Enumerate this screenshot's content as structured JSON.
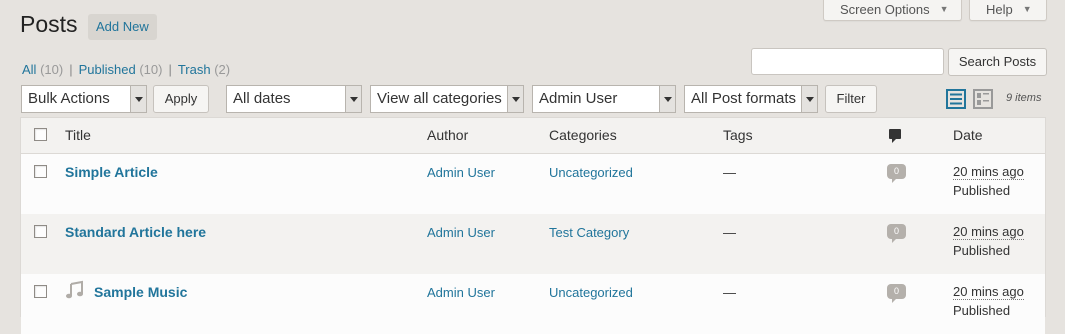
{
  "header": {
    "title": "Posts",
    "add_new": "Add New",
    "screen_options": "Screen Options",
    "help": "Help"
  },
  "filters_links": [
    {
      "label": "All",
      "count": "(10)"
    },
    {
      "label": "Published",
      "count": "(10)"
    },
    {
      "label": "Trash",
      "count": "(2)"
    }
  ],
  "search": {
    "value": "",
    "button": "Search Posts"
  },
  "toolbar": {
    "bulk_actions": "Bulk Actions",
    "apply": "Apply",
    "dates": "All dates",
    "categories": "View all categories",
    "author": "Admin User",
    "formats": "All Post formats",
    "filter": "Filter",
    "items_count": "9 items"
  },
  "table": {
    "headers": {
      "title": "Title",
      "author": "Author",
      "categories": "Categories",
      "tags": "Tags",
      "date": "Date"
    },
    "rows": [
      {
        "title": "Simple Article",
        "author": "Admin User",
        "category": "Uncategorized",
        "tags": "—",
        "comments": "0",
        "date": "20 mins ago",
        "status": "Published"
      },
      {
        "title": "Standard Article here",
        "author": "Admin User",
        "category": "Test Category",
        "tags": "—",
        "comments": "0",
        "date": "20 mins ago",
        "status": "Published"
      },
      {
        "title": "Sample Music",
        "author": "Admin User",
        "category": "Uncategorized",
        "tags": "—",
        "comments": "0",
        "date": "20 mins ago",
        "status": "Published",
        "format_icon": "music-note-icon"
      }
    ]
  },
  "colors": {
    "link": "#21759b",
    "background": "#e6e3df",
    "bubble": "#b4b0ab"
  }
}
